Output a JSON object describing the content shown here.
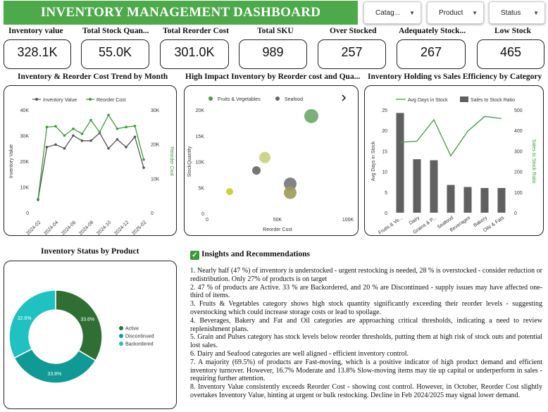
{
  "header": {
    "title": "INVENTORY MANAGEMENT DASHBOARD"
  },
  "filters": [
    {
      "label": "Catag..."
    },
    {
      "label": "Product"
    },
    {
      "label": "Status"
    }
  ],
  "kpis": [
    {
      "label": "Inventory value",
      "value": "328.1K"
    },
    {
      "label": "Total Stock Quan...",
      "value": "55.0K"
    },
    {
      "label": "Total Reorder Cost",
      "value": "301.0K"
    },
    {
      "label": "Total SKU",
      "value": "989"
    },
    {
      "label": "Over Stocked",
      "value": "257"
    },
    {
      "label": "Adequately Stock...",
      "value": "267"
    },
    {
      "label": "Low Stock",
      "value": "465"
    }
  ],
  "colors": {
    "accent": "#4caa4a",
    "line_green": "#3e9b3e",
    "line_gray": "#555555",
    "bar_gray": "#606060",
    "donut_active": "#2f6f34",
    "donut_discontinued": "#0f9a96",
    "donut_backordered": "#1fc1c1"
  },
  "chart_data": [
    {
      "id": "trend",
      "type": "line",
      "title": "Inventory & Reorder Cost Trend by Month",
      "ylabel": "Inventory Value",
      "y2label": "Reorder Cost",
      "x_ticks": [
        "2024-02",
        "2024-04",
        "2024-06",
        "2024-08",
        "2024-10",
        "2024-12",
        "2025-02"
      ],
      "ylim": [
        0,
        40000
      ],
      "y2lim": [
        0,
        30000
      ],
      "yticks": [
        "0",
        "10K",
        "20K",
        "30K",
        "40K"
      ],
      "y2ticks": [
        "0",
        "10K",
        "20K",
        "30K"
      ],
      "series": [
        {
          "name": "Inventory Value",
          "axis": "left",
          "values": [
            5000,
            25500,
            26500,
            25000,
            30000,
            28000,
            28000,
            31000,
            25000,
            28500,
            25500,
            29500,
            17500
          ]
        },
        {
          "name": "Reorder Cost",
          "axis": "right",
          "values": [
            4000,
            25000,
            25200,
            22500,
            24500,
            23000,
            27000,
            23500,
            28500,
            24500,
            25000,
            25300,
            15500
          ]
        }
      ]
    },
    {
      "id": "scatter",
      "type": "scatter",
      "title": "High Impact Inventory by Reorder cost and Qua...",
      "xlabel": "Reorder Cost",
      "ylabel": "StockQuantity",
      "xlim": [
        0,
        100000
      ],
      "ylim": [
        0,
        20000
      ],
      "xticks": [
        "0",
        "50K",
        "100K"
      ],
      "yticks": [
        "0",
        "5K",
        "10K",
        "15K",
        "20K"
      ],
      "legend": [
        "Fruits & Vegetables",
        "Seafood"
      ],
      "points": [
        {
          "x": 16000,
          "y": 4200,
          "r": 5,
          "color": "#c9cc2a"
        },
        {
          "x": 35000,
          "y": 8300,
          "r": 6,
          "color": "#666666"
        },
        {
          "x": 41000,
          "y": 10800,
          "r": 8,
          "color": "#c8cf7e"
        },
        {
          "x": 59000,
          "y": 5700,
          "r": 9,
          "color": "#777777"
        },
        {
          "x": 59000,
          "y": 4000,
          "r": 9,
          "color": "#9f9a58"
        },
        {
          "x": 74000,
          "y": 18800,
          "r": 10,
          "color": "#6aa86a"
        }
      ]
    },
    {
      "id": "holding",
      "type": "bar",
      "title": "Inventory Holding vs Sales Efficiency by Category",
      "ylabel": "Avg Days in Stock",
      "y2label": "Sales to Stock Ratio",
      "legend": [
        "Avg Days in Stock",
        "Sales to Stock Ratio"
      ],
      "categories": [
        "Fruits & Ve...",
        "Dairy",
        "Grains & P...",
        "Seafood",
        "Beverages",
        "Bakery",
        "Oils & Fats"
      ],
      "ylim": [
        0,
        25
      ],
      "y2lim": [
        0,
        500
      ],
      "yticks": [
        "0",
        "5",
        "10",
        "15",
        "20",
        "25"
      ],
      "y2ticks": [
        "0",
        "100",
        "200",
        "300",
        "400",
        "500"
      ],
      "bars": [
        485,
        260,
        255,
        135,
        125,
        120,
        120
      ],
      "line": [
        17.1,
        17.4,
        22.6,
        13.8,
        19.8,
        23.4,
        22.9
      ]
    },
    {
      "id": "status",
      "type": "pie",
      "title": "Inventory Status by Product",
      "slices": [
        {
          "label": "Active",
          "value": 33.6,
          "text": "33.6%"
        },
        {
          "label": "Discontinued",
          "value": 33.8,
          "text": "33.8%"
        },
        {
          "label": "Backordered",
          "value": 32.6,
          "text": "32.6%"
        }
      ],
      "note_label_backordered": "32.6%"
    }
  ],
  "insights": {
    "title": "Insights and Recommendations",
    "items": [
      "1. Nearly half (47 %) of inventory is understocked - urgent restocking is needed, 28 % is overstocked - consider reduction or redistribution. Only 27% of products is on target",
      "2. 47 % of products are Active. 33 % are Backordered, and 20 % are Discontinued - supply issues may have affected one-third of items.",
      "3. Fruits & Vegetables category shows high stock quantity significantly exceeding their reorder levels - suggesting overstocking which could increase storage costs or lead to spoilage.",
      "4. Beverages, Bakery and Fat and Oil categories are approaching critical thresholds, indicating a need to review replenishment plans.",
      "5. Grain and Pulses category has stock levels below reorder thresholds, putting them at high risk of stock outs and potential lost sales.",
      "6. Dairy and Seafood categories are well aligned - efficient inventory control.",
      "7. A majority (69.5%) of products are Fast-moving, which is a positive indicator of high product demand and efficient inventory turnover. However, 16.7% Moderate and 13.8% Slow-moving items may tie up capital or underperform in sales - requiring further attention.",
      "8. Inventory Value consistently exceeds Reorder Cost - showing cost control. However, in October, Reorder Cost slightly overtakes Inventory Value, hinting at urgent or bulk restocking. Decline in Feb 2024/2025 may signal lower demand."
    ]
  }
}
